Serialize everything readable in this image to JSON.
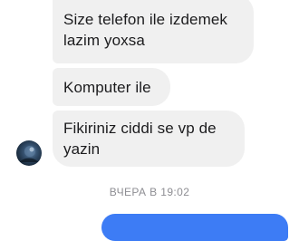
{
  "messages": [
    {
      "text_line1": "Size telefon ile izdemek",
      "text_line2": "lazim yoxsa"
    },
    {
      "text": "Komputer ile"
    },
    {
      "text_line1": "Fikiriniz ciddi se vp de",
      "text_line2": "yazin"
    }
  ],
  "timestamp": "ВЧЕРА В 19:02",
  "colors": {
    "incoming_bubble": "#f0f0f0",
    "outgoing_bubble": "#3d7cf5",
    "timestamp_text": "#8e8e93"
  },
  "avatar": {
    "icon": "avatar-icon"
  }
}
